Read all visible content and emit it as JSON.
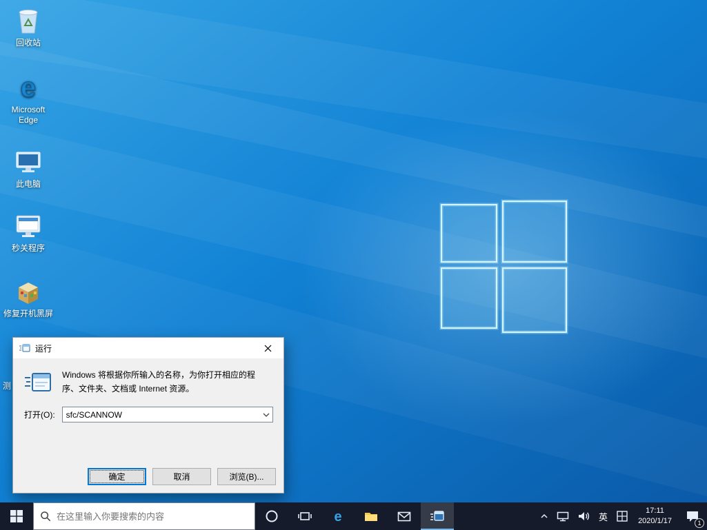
{
  "desktop": {
    "icons": [
      {
        "label": "回收站",
        "icon": "recycle-bin-icon"
      },
      {
        "label": "Microsoft Edge",
        "icon": "edge-icon"
      },
      {
        "label": "此电脑",
        "icon": "this-pc-icon"
      },
      {
        "label": "秒关程序",
        "icon": "program-monitor-icon"
      },
      {
        "label": "修复开机黑屏",
        "icon": "repair-toolbox-icon"
      },
      {
        "label": "测",
        "icon": "partially-hidden-icon"
      }
    ]
  },
  "run_dialog": {
    "title": "运行",
    "description": "Windows 将根据你所输入的名称，为你打开相应的程序、文件夹、文档或 Internet 资源。",
    "open_label": "打开(O):",
    "input_value": "sfc/SCANNOW",
    "buttons": {
      "ok": "确定",
      "cancel": "取消",
      "browse": "浏览(B)..."
    }
  },
  "taskbar": {
    "search": {
      "placeholder": "在这里输入你要搜索的内容"
    },
    "tray": {
      "language": "英",
      "time": "17:11",
      "date": "2020/1/17",
      "notification_count": "1"
    }
  },
  "colors": {
    "accent": "#0078d7",
    "taskbar_bg": "#161b2b",
    "wallpaper_top": "#36a5e5",
    "wallpaper_bottom": "#0a58a6"
  }
}
